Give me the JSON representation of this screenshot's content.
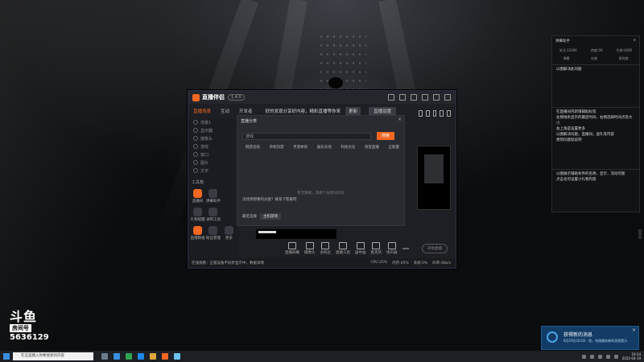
{
  "app": {
    "title": "直播伴侣",
    "version_badge": "1.4.0",
    "tabs": [
      "直播场景",
      "互动",
      "开发者"
    ],
    "notice": "好的发现分享好内容，精彩直播等你来",
    "notice_button": "更新",
    "right_button": "直播设置"
  },
  "sidebar": {
    "scene_label": "场景1",
    "scenes": [
      "显示器",
      "摄像头",
      "游戏",
      "窗口",
      "图片",
      "文字"
    ],
    "tools_title": "工具箱",
    "tools": [
      {
        "label": "直播间",
        "icon": "camera-icon",
        "accent": true
      },
      {
        "label": "弹幕助手",
        "icon": "chat-icon",
        "accent": false
      },
      {
        "label": "",
        "icon": "blank-icon",
        "accent": false
      },
      {
        "label": "礼物提醒",
        "icon": "gift-icon",
        "accent": false
      },
      {
        "label": "录制工具",
        "icon": "record-icon",
        "accent": false
      },
      {
        "label": "",
        "icon": "blank-icon",
        "accent": false
      },
      {
        "label": "直播数据",
        "icon": "chart-icon",
        "accent": true
      },
      {
        "label": "粉丝管理",
        "icon": "fans-icon",
        "accent": false
      },
      {
        "label": "更多",
        "icon": "more-icon",
        "accent": false
      }
    ]
  },
  "modal": {
    "title": "直播分类",
    "search_placeholder": "游戏",
    "search_button": "搜索",
    "categories": [
      "网游竞技",
      "单机热游",
      "手游休闲",
      "娱乐天地",
      "科技文化",
      "语音直播",
      "正能量"
    ],
    "empty_message": "暂无数据，请换个关键词试试",
    "contact": "没找到想要的分类？联系下客服吧",
    "bottom_label": "最近选择",
    "bottom_button": "主机游戏"
  },
  "toolbar": {
    "items": [
      "直播屏幕",
      "摄像头",
      "多机位",
      "直播工具",
      "画中画",
      "麦克风",
      "扬声器"
    ],
    "start_button": "开始直播"
  },
  "status": {
    "left": "在线观看：正版设备不同步显示中，数据详情",
    "right": [
      "CPU:25%",
      "内存:45%",
      "丢帧:0%",
      "码率:0kb/s"
    ]
  },
  "notes": {
    "header": "弹幕助手",
    "stats": [
      "关注:12066",
      "热度:00",
      "礼物:4085"
    ],
    "tabs": [
      "弹幕",
      "礼物",
      "贵宾席"
    ],
    "blocks": [
      "以图解决此问题",
      "在直播间内新增辅助标签\n左侧线条显示的最后时间，右侧选择时间点及大小\n右上角是设置更多\n以图解决问题，直播间，送礼等内容\n想到问题就说吧",
      "以图展示辅助条件的名称，显示，流动可能\n点击也可设置小礼物内容"
    ]
  },
  "watermark": {
    "logo": "斗鱼",
    "room_label": "房间号",
    "room_number": "5636129"
  },
  "toast": {
    "title": "获得新的消息",
    "body": "6月29日16:02 - 鱼，系统服务新的消息提示"
  },
  "taskbar": {
    "search_placeholder": "在这里输入你要搜索的内容",
    "time": "19:34",
    "date": "2022-04-19"
  },
  "colors": {
    "accent": "#f26722",
    "toast_bg": "#123c66"
  }
}
